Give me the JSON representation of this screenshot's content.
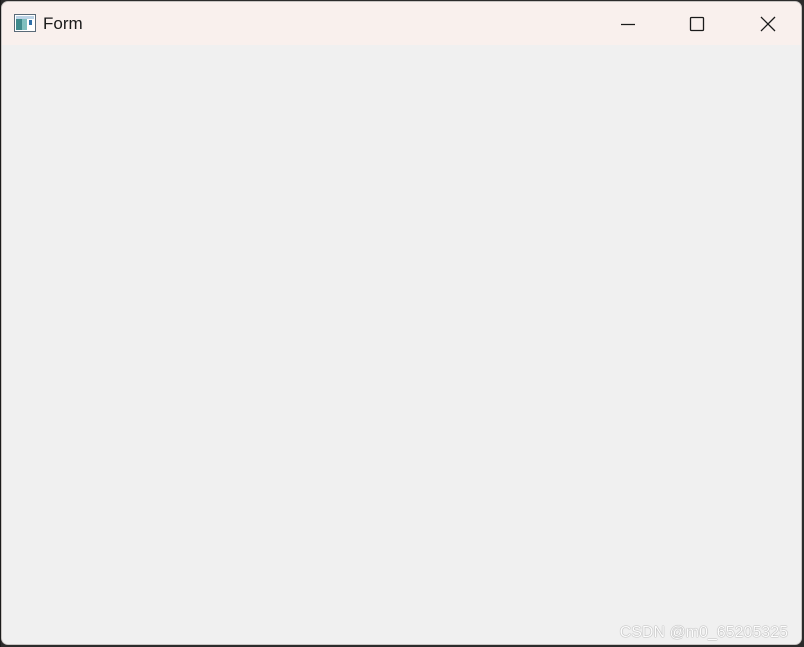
{
  "window": {
    "title": "Form",
    "controls": {
      "minimize": "minimize-icon",
      "maximize": "maximize-icon",
      "close": "close-icon"
    },
    "titlebar_color": "#f9f0ed",
    "client_color": "#f0f0f0"
  },
  "watermark": {
    "text": "CSDN @m0_65205325"
  }
}
